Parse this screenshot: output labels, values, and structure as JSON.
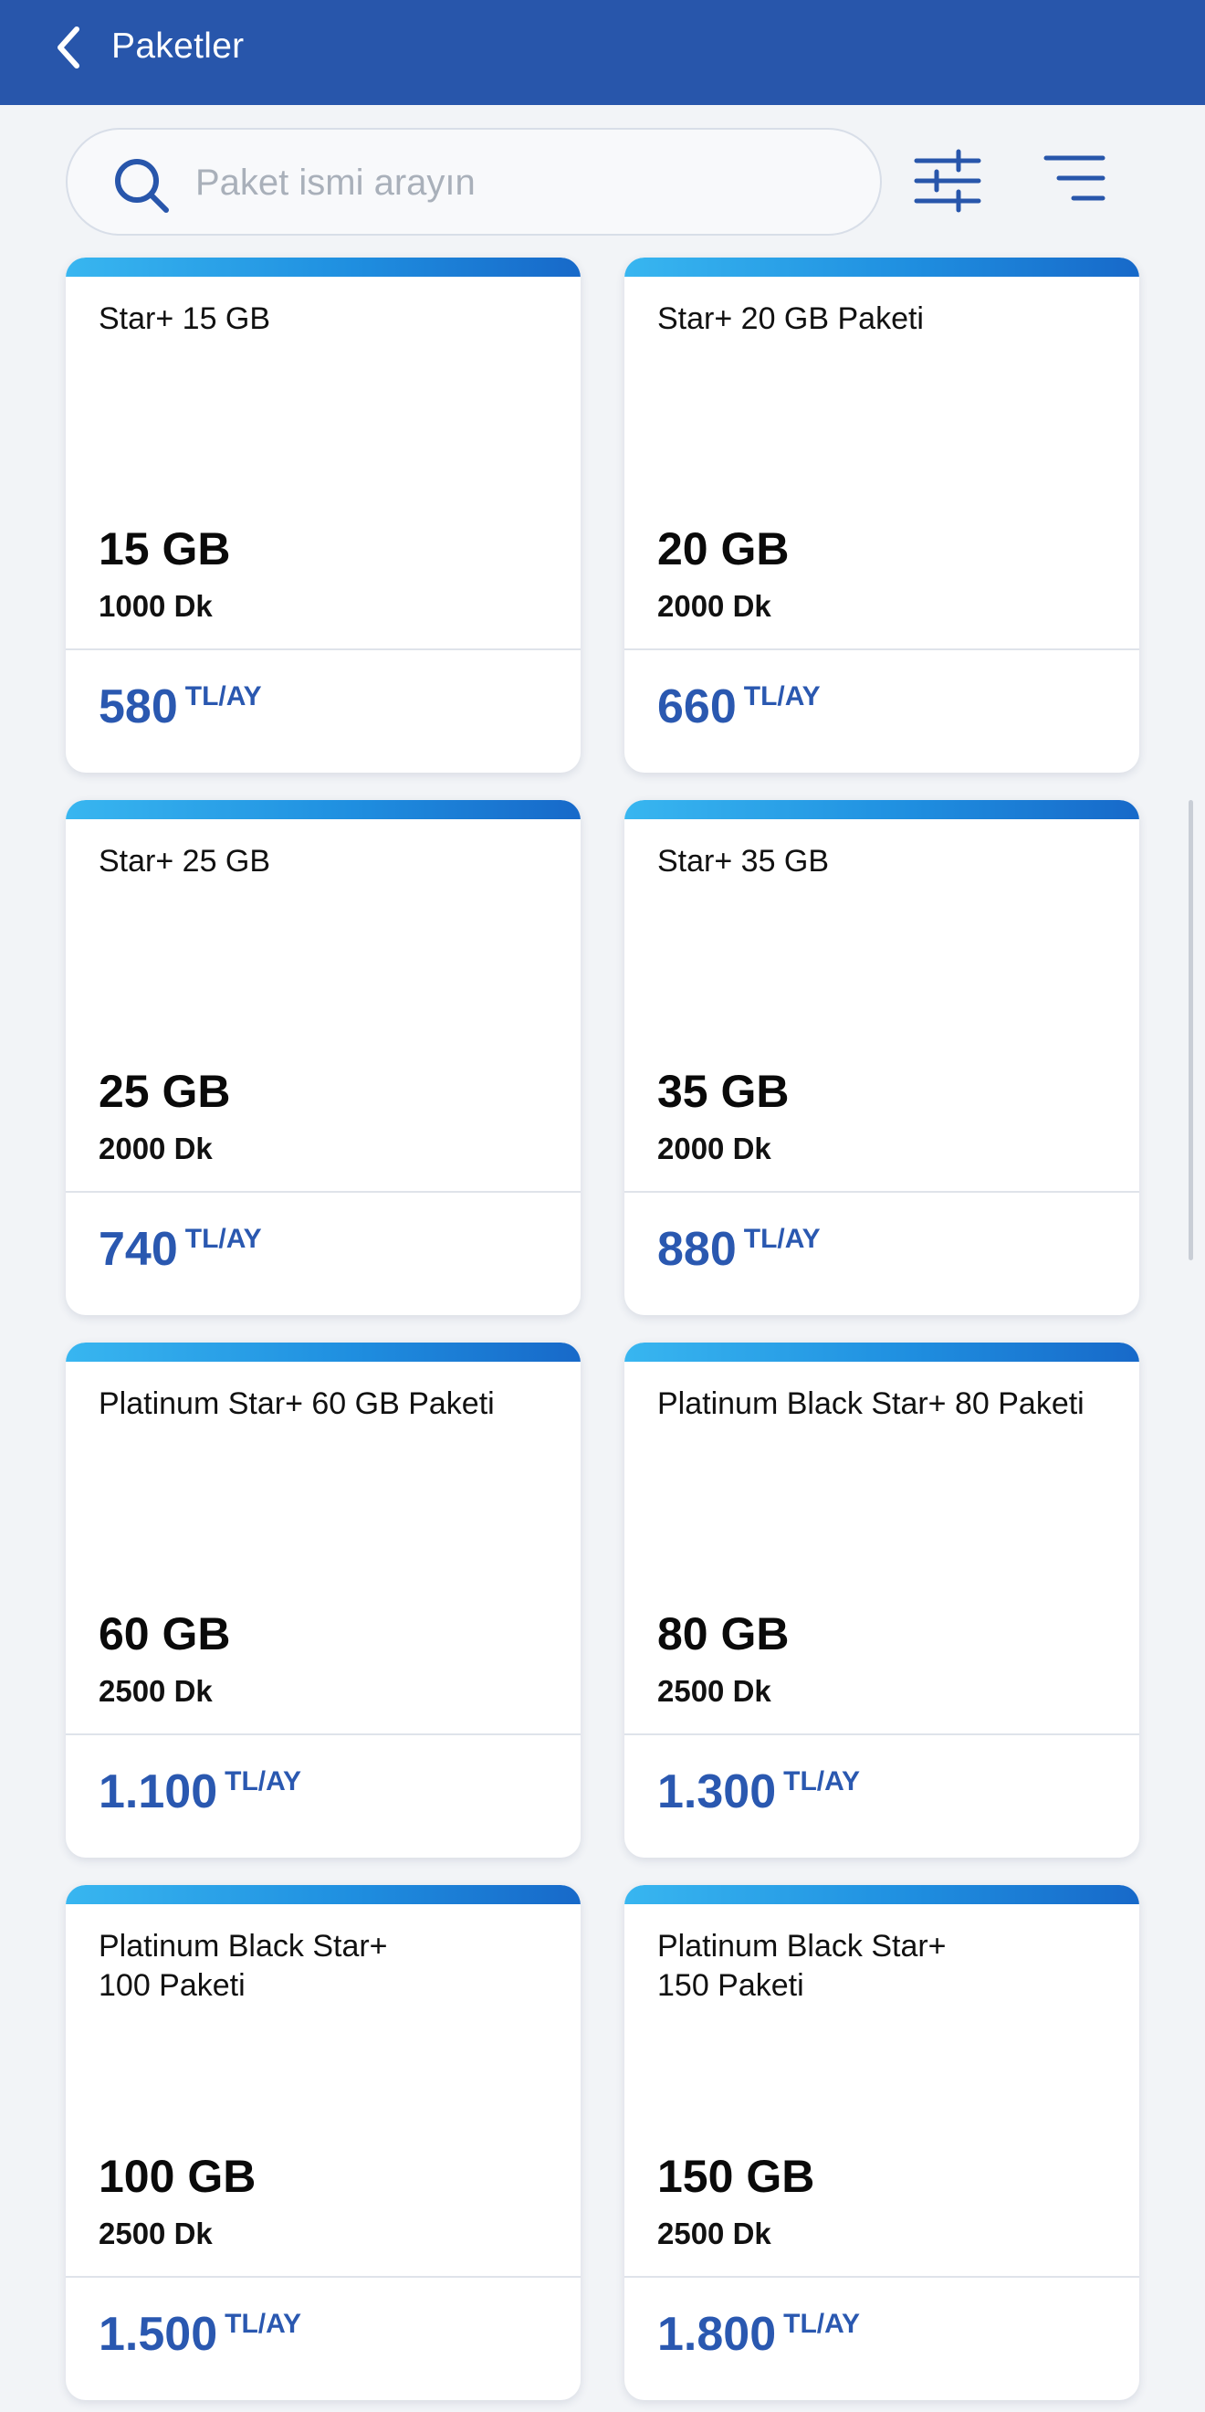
{
  "header": {
    "title": "Paketler",
    "background_color": "#2856ab"
  },
  "search": {
    "placeholder": "Paket ismi arayın",
    "value": ""
  },
  "toolbar": {
    "filter_icon": "sliders-icon",
    "sort_icon": "sort-lines-icon"
  },
  "accent_color": "#2a58b0",
  "packages": [
    {
      "name": "Star+ 15 GB",
      "data": "15 GB",
      "minutes": "1000 Dk",
      "price": "580",
      "unit": "TL/AY"
    },
    {
      "name": "Star+ 20 GB Paketi",
      "data": "20 GB",
      "minutes": "2000 Dk",
      "price": "660",
      "unit": "TL/AY"
    },
    {
      "name": "Star+ 25 GB",
      "data": "25 GB",
      "minutes": "2000 Dk",
      "price": "740",
      "unit": "TL/AY"
    },
    {
      "name": "Star+ 35 GB",
      "data": "35 GB",
      "minutes": "2000 Dk",
      "price": "880",
      "unit": "TL/AY"
    },
    {
      "name": "Platinum Star+ 60 GB Paketi",
      "data": "60 GB",
      "minutes": "2500 Dk",
      "price": "1.100",
      "unit": "TL/AY"
    },
    {
      "name": "Platinum Black Star+ 80 Paketi",
      "data": "80 GB",
      "minutes": "2500 Dk",
      "price": "1.300",
      "unit": "TL/AY"
    },
    {
      "name": "Platinum Black Star+\n100 Paketi",
      "data": "100 GB",
      "minutes": "2500 Dk",
      "price": "1.500",
      "unit": "TL/AY"
    },
    {
      "name": "Platinum Black Star+\n150 Paketi",
      "data": "150 GB",
      "minutes": "2500 Dk",
      "price": "1.800",
      "unit": "TL/AY"
    }
  ]
}
